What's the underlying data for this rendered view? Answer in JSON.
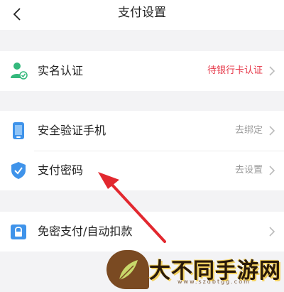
{
  "header": {
    "title": "支付设置"
  },
  "groups": [
    {
      "rows": [
        {
          "label": "实名认证",
          "value": "待银行卡认证"
        }
      ]
    },
    {
      "rows": [
        {
          "label": "安全验证手机",
          "value": "去绑定"
        },
        {
          "label": "支付密码",
          "value": "去设置"
        }
      ]
    },
    {
      "rows": [
        {
          "label": "免密支付/自动扣款",
          "value": ""
        }
      ]
    }
  ],
  "watermark": {
    "text": "大不同手游网",
    "url": "www.szdbtgg.com"
  },
  "colors": {
    "alert": "#e6394a",
    "accent": "#3f93ea",
    "arrow": "#e2282f"
  }
}
